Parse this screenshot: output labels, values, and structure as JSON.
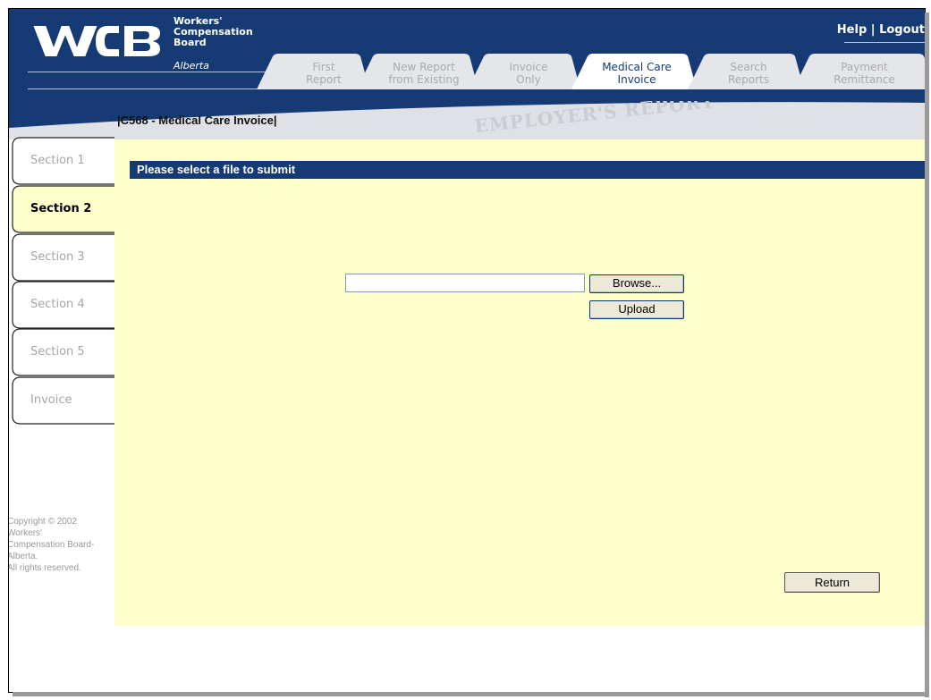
{
  "header": {
    "logo_text": "WCB",
    "board_name": [
      "Workers'",
      "Compensation",
      "Board"
    ],
    "province": "Alberta",
    "help_label": "Help",
    "separator": " | ",
    "logout_label": "Logout"
  },
  "tabs": [
    {
      "label": "First\nReport",
      "active": false
    },
    {
      "label": "New Report\nfrom Existing",
      "active": false
    },
    {
      "label": "Invoice\nOnly",
      "active": false
    },
    {
      "label": "Medical Care\nInvoice",
      "active": true
    },
    {
      "label": "Search\nReports",
      "active": false
    },
    {
      "label": "Payment\nRemittance",
      "active": false
    }
  ],
  "banner": {
    "watermark": "EMPLOYER'S REPORT",
    "page_title": "|C568 - Medical Care Invoice|"
  },
  "sidebar": {
    "items": [
      {
        "label": "Section 1",
        "active": false
      },
      {
        "label": "Section 2",
        "active": true
      },
      {
        "label": "Section 3",
        "active": false
      },
      {
        "label": "Section 4",
        "active": false
      },
      {
        "label": "Section 5",
        "active": false
      },
      {
        "label": "Invoice",
        "active": false
      }
    ],
    "copyright": [
      "Copyright © 2002",
      "Workers'",
      "Compensation Board-",
      "Alberta.",
      "All rights reserved."
    ]
  },
  "main": {
    "section_heading": "Please select a file to submit",
    "file_input_value": "",
    "browse_label": "Browse...",
    "upload_label": "Upload",
    "return_label": "Return"
  },
  "colors": {
    "header_blue": "#163a73",
    "content_bg": "#ffffcc",
    "inactive_text": "#a6a6a6"
  }
}
